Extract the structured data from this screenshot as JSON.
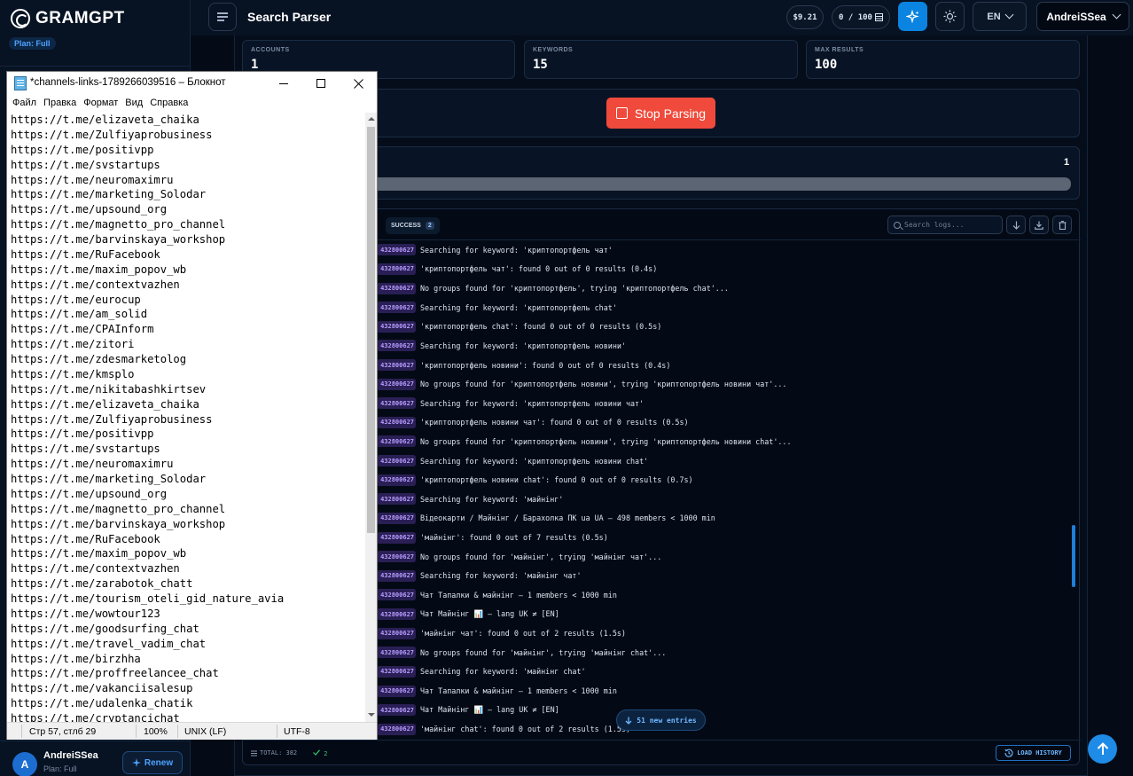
{
  "brand": {
    "name": "GRAMGPT",
    "plan_badge": "Plan: Full"
  },
  "sidebar_footer": {
    "avatar_letter": "A",
    "user_name": "AndreiSSea",
    "user_plan": "Plan: Full",
    "renew_label": "Renew"
  },
  "topbar": {
    "title": "Search Parser",
    "balance": "$9.21",
    "credits": "0 / 100",
    "language": "EN",
    "user": "AndreiSSea"
  },
  "stats": {
    "accounts": {
      "label": "ACCOUNTS",
      "value": "1"
    },
    "keywords": {
      "label": "KEYWORDS",
      "value": "15"
    },
    "max_results": {
      "label": "MAX RESULTS",
      "value": "100"
    }
  },
  "action": {
    "stop_label": "Stop Parsing"
  },
  "progress": {
    "count": "1",
    "fraction": 1.0
  },
  "logs": {
    "tab_success_label": "SUCCESS",
    "tab_success_count": "2",
    "search_placeholder": "Search logs...",
    "tag": "432800627",
    "entries": [
      "Searching for keyword: 'криптопортфель чат'",
      "'криптопортфель чат': found 0 out of 0 results (0.4s)",
      "No groups found for 'криптопортфель', trying 'криптопортфель chat'...",
      "Searching for keyword: 'криптопортфель chat'",
      "'криптопортфель chat': found 0 out of 0 results (0.5s)",
      "Searching for keyword: 'криптопортфель новини'",
      "'криптопортфель новини': found 0 out of 0 results (0.4s)",
      "No groups found for 'криптопортфель новини', trying 'криптопортфель новини чат'...",
      "Searching for keyword: 'криптопортфель новини чат'",
      "'криптопортфель новини чат': found 0 out of 0 results (0.5s)",
      "No groups found for 'криптопортфель новини', trying 'криптопортфель новини chat'...",
      "Searching for keyword: 'криптопортфель новини chat'",
      "'криптопортфель новини chat': found 0 out of 0 results (0.7s)",
      "Searching for keyword: 'майнінг'",
      "Відеокарти / Майнінг / Барахолка ПК ua UA – 498 members < 1000 min",
      "'майнінг': found 0 out of 7 results (0.5s)",
      "No groups found for 'майнінг', trying 'майнінг чат'...",
      "Searching for keyword: 'майнінг чат'",
      "Чат Тапалки & майнінг – 1 members < 1000 min",
      "Чат Майнінг 📊 – lang UK ≠ [EN]",
      "'майнінг чат': found 0 out of 2 results (1.5s)",
      "No groups found for 'майнінг', trying 'майнінг chat'...",
      "Searching for keyword: 'майнінг chat'",
      "Чат Тапалки & майнінг – 1 members < 1000 min",
      "Чат Майнінг 📊 – lang UK ≠ [EN]",
      "'майнінг chat': found 0 out of 2 results (1.5s)"
    ],
    "new_entries_label": "51 new entries",
    "footer_total": "TOTAL: 382",
    "footer_ok": "2",
    "load_history_label": "LOAD HISTORY"
  },
  "notepad": {
    "title": "*channels-links-1789266039516 – Блокнот",
    "menu": [
      "Файл",
      "Правка",
      "Формат",
      "Вид",
      "Справка"
    ],
    "lines": [
      "https://t.me/elizaveta_chaika",
      "https://t.me/Zulfiyaprobusiness",
      "https://t.me/positivpp",
      "https://t.me/svstartups",
      "https://t.me/neuromaximru",
      "https://t.me/marketing_Solodar",
      "https://t.me/upsound_org",
      "https://t.me/magnetto_pro_channel",
      "https://t.me/barvinskaya_workshop",
      "https://t.me/RuFacebook",
      "https://t.me/maxim_popov_wb",
      "https://t.me/contextvazhen",
      "https://t.me/eurocup",
      "https://t.me/am_solid",
      "https://t.me/CPAInform",
      "https://t.me/zitori",
      "https://t.me/zdesmarketolog",
      "https://t.me/kmsplo",
      "https://t.me/nikitabashkirtsev",
      "https://t.me/elizaveta_chaika",
      "https://t.me/Zulfiyaprobusiness",
      "https://t.me/positivpp",
      "https://t.me/svstartups",
      "https://t.me/neuromaximru",
      "https://t.me/marketing_Solodar",
      "https://t.me/upsound_org",
      "https://t.me/magnetto_pro_channel",
      "https://t.me/barvinskaya_workshop",
      "https://t.me/RuFacebook",
      "https://t.me/maxim_popov_wb",
      "https://t.me/contextvazhen",
      "https://t.me/zarabotok_chatt",
      "https://t.me/tourism_oteli_gid_nature_avia",
      "https://t.me/wowtour123",
      "https://t.me/goodsurfing_chat",
      "https://t.me/travel_vadim_chat",
      "https://t.me/birzhha",
      "https://t.me/proffreelancee_chat",
      "https://t.me/vakanciisalesup",
      "https://t.me/udalenka_chatik",
      "https://t.me/cryptancichat"
    ],
    "status": {
      "position": "Стр 57, стлб 29",
      "zoom": "100%",
      "eol": "UNIX (LF)",
      "encoding": "UTF-8"
    }
  },
  "colors": {
    "accent": "#0a84e0",
    "stop": "#ef4a3b",
    "tag_bg": "#2a1f55",
    "tag_text": "#b79cff"
  }
}
